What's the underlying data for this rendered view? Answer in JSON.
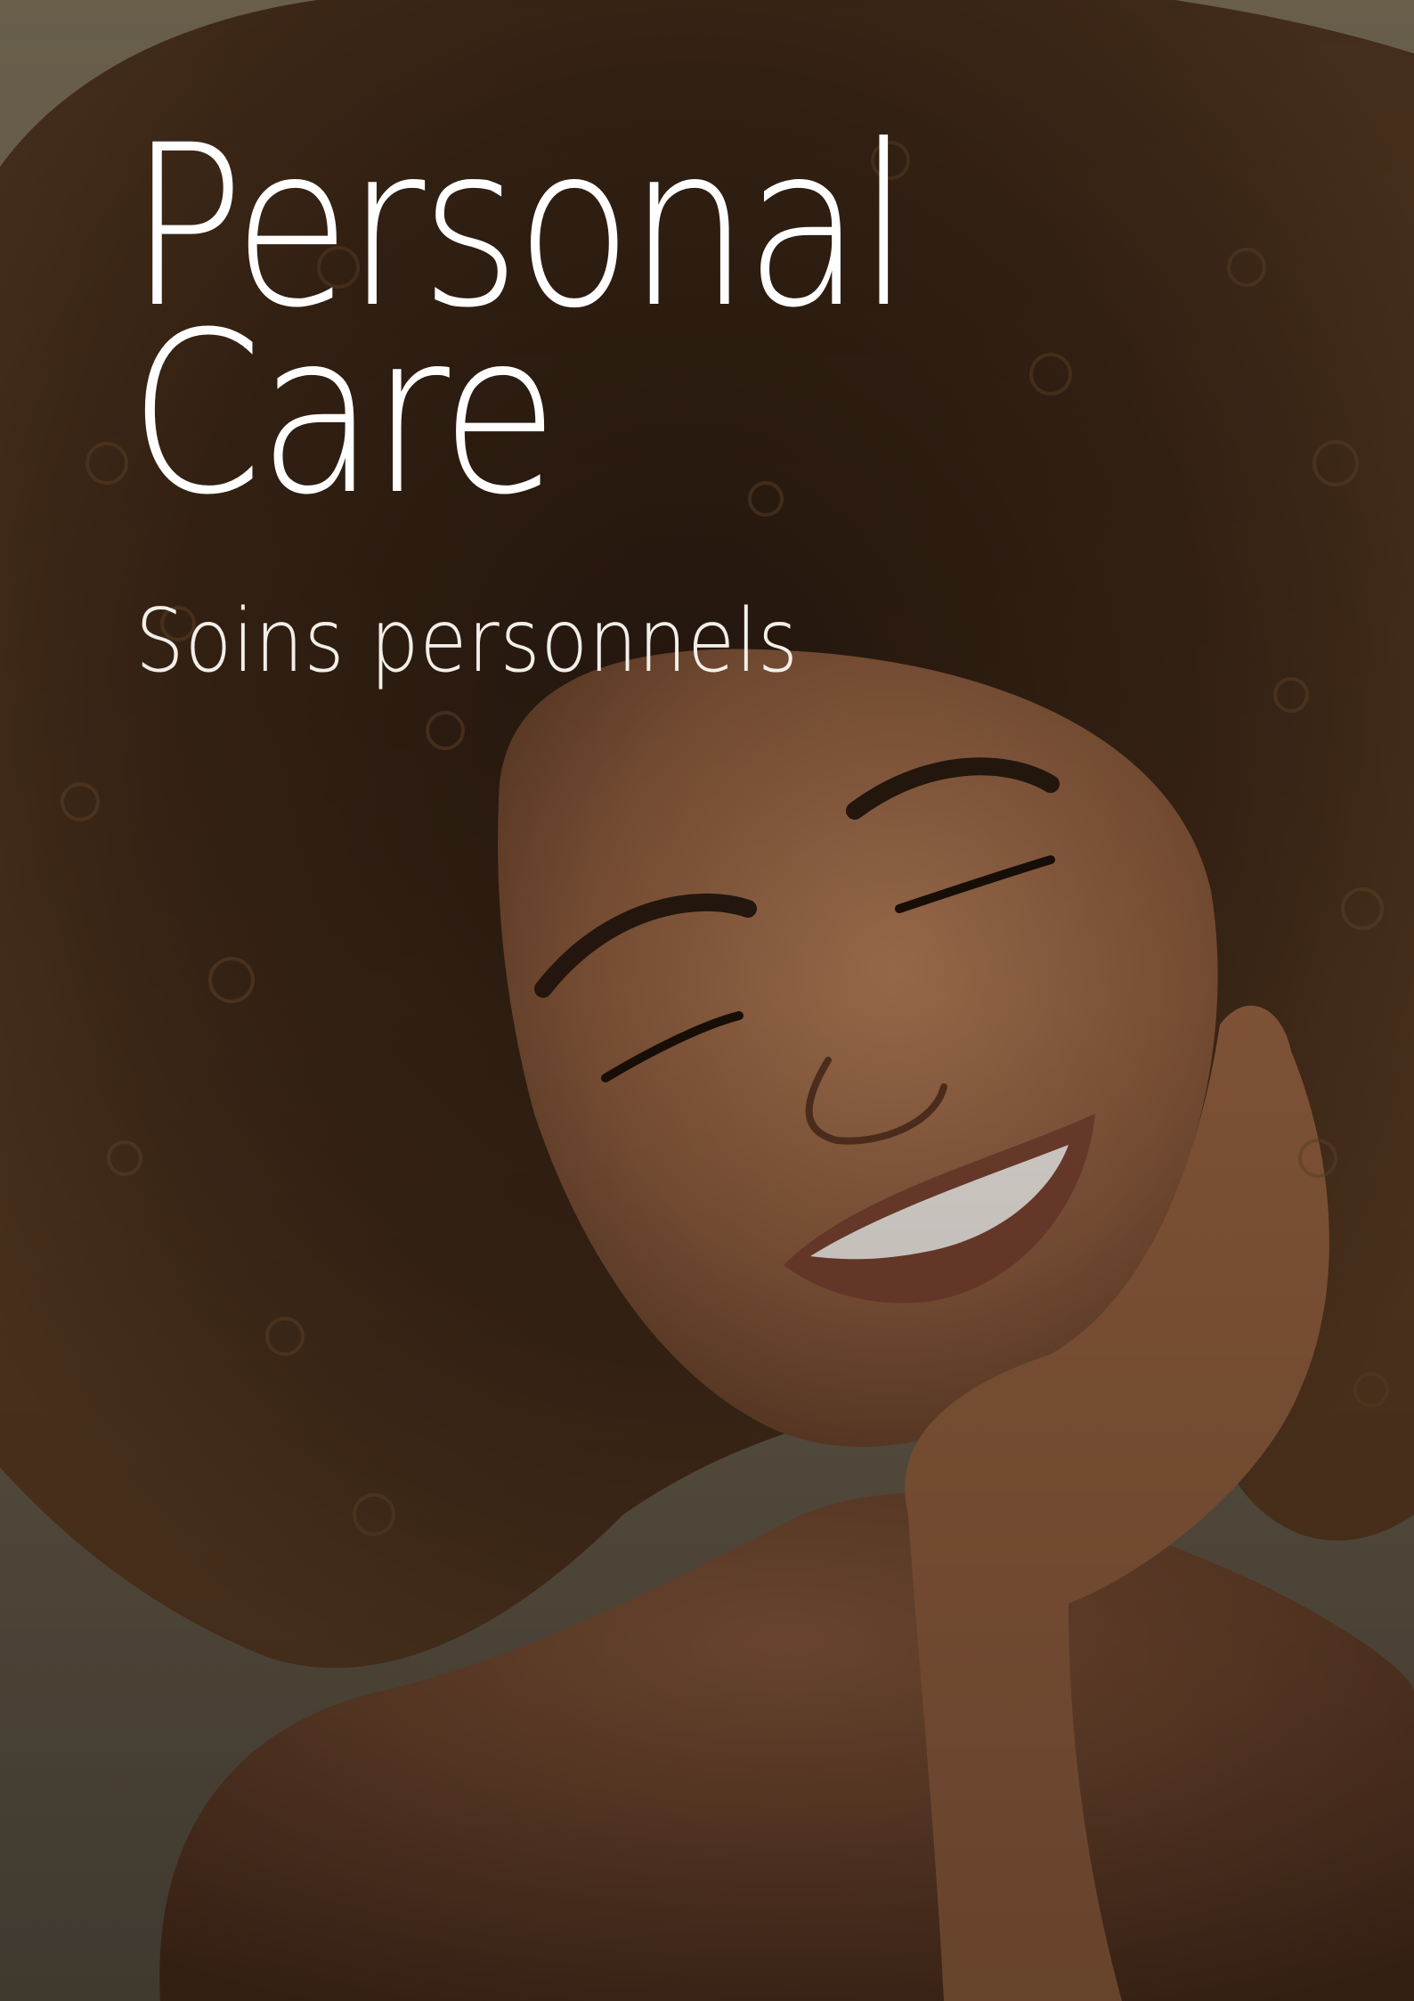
{
  "cover": {
    "title_line1": "Personal",
    "title_line2": "Care",
    "subtitle": "Soins personnels"
  },
  "colors": {
    "background": "#6f6450",
    "hair": "#3b2616",
    "skin": "#8a5a3c",
    "title_text": "#ffffff"
  }
}
